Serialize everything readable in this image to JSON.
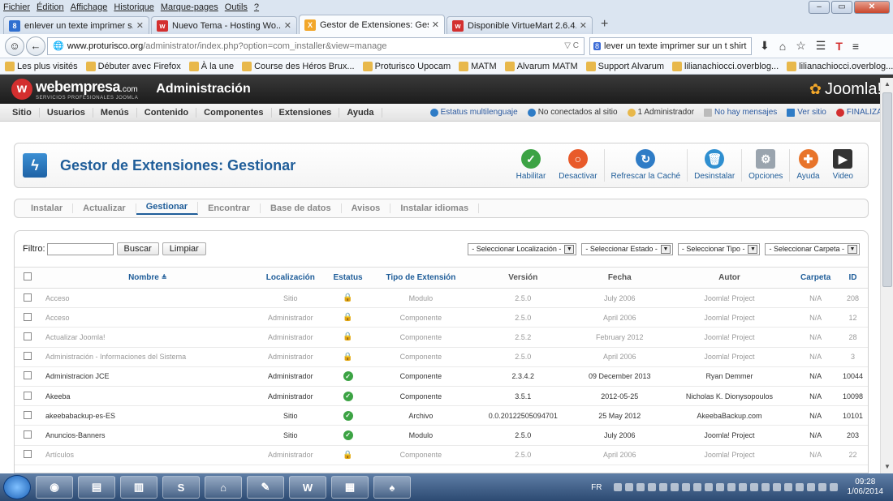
{
  "ff": {
    "menu": [
      "Fichier",
      "Édition",
      "Affichage",
      "Historique",
      "Marque-pages",
      "Outils",
      "?"
    ],
    "tabs": [
      {
        "label": "enlever un texte imprimer s...",
        "icon": "8",
        "color": "#2f6fd0",
        "active": false
      },
      {
        "label": "Nuevo Tema - Hosting Wo...",
        "icon": "w",
        "color": "#d32f2f",
        "active": false
      },
      {
        "label": "Gestor de Extensiones: Gest...",
        "icon": "X",
        "color": "#f2a72a",
        "active": true
      },
      {
        "label": "Disponible VirtueMart 2.6.4...",
        "icon": "w",
        "color": "#d32f2f",
        "active": false
      }
    ],
    "url_host": "www.proturisco.org",
    "url_path": "/administrator/index.php?option=com_installer&view=manage",
    "search": "lever un texte imprimer sur un t shirt",
    "bookmarks": [
      "Les plus visités",
      "Débuter avec Firefox",
      "À la une",
      "Course des Héros Brux...",
      "Proturisco Upocam",
      "MATM",
      "Alvarum MATM",
      "Support Alvarum",
      "lilianachiocci.overblog...",
      "lilianachiocci.overblog..."
    ]
  },
  "joomla": {
    "logo": "webempresa",
    "logo_tld": ".com",
    "logo_sub": "SERVICIOS PROFESIONALES JOOMLA",
    "admin_title": "Administración",
    "brand": "Joomla!",
    "menu": [
      "Sitio",
      "Usuarios",
      "Menús",
      "Contenido",
      "Componentes",
      "Extensiones",
      "Ayuda"
    ],
    "status": {
      "multilang": "Estatus multilenguaje",
      "visitors": "No conectados al sitio",
      "admins": "1 Administrador",
      "messages": "No hay mensajes",
      "view_site": "Ver sitio",
      "logout": "FINALIZAR"
    },
    "page_title": "Gestor de Extensiones: Gestionar",
    "toolbar": [
      {
        "label": "Habilitar",
        "icon": "check-icon",
        "color": "#3ca344",
        "glyph": "✓"
      },
      {
        "label": "Desactivar",
        "icon": "stop-icon",
        "color": "#e85a2a",
        "glyph": "○"
      },
      {
        "label": "Refrescar la Caché",
        "icon": "refresh-icon",
        "color": "#2f7cc6",
        "glyph": "↻"
      },
      {
        "label": "Desinstalar",
        "icon": "trash-icon",
        "color": "#2f8fd0",
        "glyph": "🗑"
      },
      {
        "label": "Opciones",
        "icon": "options-icon",
        "color": "#9aa4ae",
        "glyph": "⚙"
      },
      {
        "label": "Ayuda",
        "icon": "help-icon",
        "color": "#e8742a",
        "glyph": "✚"
      },
      {
        "label": "Video",
        "icon": "video-icon",
        "color": "#333333",
        "glyph": "▶"
      }
    ],
    "subtabs": [
      "Instalar",
      "Actualizar",
      "Gestionar",
      "Encontrar",
      "Base de datos",
      "Avisos",
      "Instalar idiomas"
    ],
    "active_subtab": 2,
    "filter": {
      "label": "Filtro:",
      "value": "",
      "search_btn": "Buscar",
      "clear_btn": "Limpiar",
      "selects": [
        "- Seleccionar Localización -",
        "- Seleccionar Estado -",
        "- Seleccionar Tipo -",
        "- Seleccionar Carpeta -"
      ]
    },
    "columns": [
      "Nombre",
      "Localización",
      "Estatus",
      "Tipo de Extensión",
      "Versión",
      "Fecha",
      "Autor",
      "Carpeta",
      "ID"
    ],
    "rows": [
      {
        "name": "Acceso",
        "loc": "Sitio",
        "status": "lock",
        "type": "Modulo",
        "version": "2.5.0",
        "date": "July 2006",
        "author": "Joomla! Project",
        "folder": "N/A",
        "id": "208"
      },
      {
        "name": "Acceso",
        "loc": "Administrador",
        "status": "lock",
        "type": "Componente",
        "version": "2.5.0",
        "date": "April 2006",
        "author": "Joomla! Project",
        "folder": "N/A",
        "id": "12"
      },
      {
        "name": "Actualizar Joomla!",
        "loc": "Administrador",
        "status": "lock",
        "type": "Componente",
        "version": "2.5.2",
        "date": "February 2012",
        "author": "Joomla! Project",
        "folder": "N/A",
        "id": "28"
      },
      {
        "name": "Administración - Informaciones del Sistema",
        "loc": "Administrador",
        "status": "lock",
        "type": "Componente",
        "version": "2.5.0",
        "date": "April 2006",
        "author": "Joomla! Project",
        "folder": "N/A",
        "id": "3"
      },
      {
        "name": "Administracion JCE",
        "loc": "Administrador",
        "status": "ok",
        "type": "Componente",
        "version": "2.3.4.2",
        "date": "09 December 2013",
        "author": "Ryan Demmer",
        "folder": "N/A",
        "id": "10044"
      },
      {
        "name": "Akeeba",
        "loc": "Administrador",
        "status": "ok",
        "type": "Componente",
        "version": "3.5.1",
        "date": "2012-05-25",
        "author": "Nicholas K. Dionysopoulos",
        "folder": "N/A",
        "id": "10098"
      },
      {
        "name": "akeebabackup-es-ES",
        "loc": "Sitio",
        "status": "ok",
        "type": "Archivo",
        "version": "0.0.20122505094701",
        "date": "25 May 2012",
        "author": "AkeebaBackup.com",
        "folder": "N/A",
        "id": "10101"
      },
      {
        "name": "Anuncios-Banners",
        "loc": "Sitio",
        "status": "ok",
        "type": "Modulo",
        "version": "2.5.0",
        "date": "July 2006",
        "author": "Joomla! Project",
        "folder": "N/A",
        "id": "203"
      },
      {
        "name": "Artículos",
        "loc": "Administrador",
        "status": "lock",
        "type": "Componente",
        "version": "2.5.0",
        "date": "April 2006",
        "author": "Joomla! Project",
        "folder": "N/A",
        "id": "22"
      }
    ]
  },
  "taskbar": {
    "lang": "FR",
    "time": "09:28",
    "date": "1/06/2014",
    "apps": [
      "firefox",
      "explorer-a",
      "explorer-b",
      "skype",
      "pdf",
      "paint",
      "word",
      "folder",
      "solitaire"
    ]
  }
}
